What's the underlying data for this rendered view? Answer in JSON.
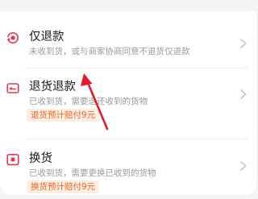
{
  "options": [
    {
      "title": "仅退款",
      "description": "未收到货，或与商家协商同意不退货仅退款",
      "icon": "refund-only-icon"
    },
    {
      "title": "退货退款",
      "description": "已收到货，需要退还收到的货物",
      "badge": "退货预计赔付9元",
      "icon": "return-refund-icon"
    },
    {
      "title": "换货",
      "description": "已收到货，需要更换已收到的货物",
      "badge": "换货预计赔付9元",
      "icon": "exchange-icon"
    }
  ],
  "colors": {
    "accent": "#e5364f",
    "badge_text": "#e36a2c",
    "badge_bg": "#fdeee2",
    "annotation_arrow": "#e01b2f"
  }
}
